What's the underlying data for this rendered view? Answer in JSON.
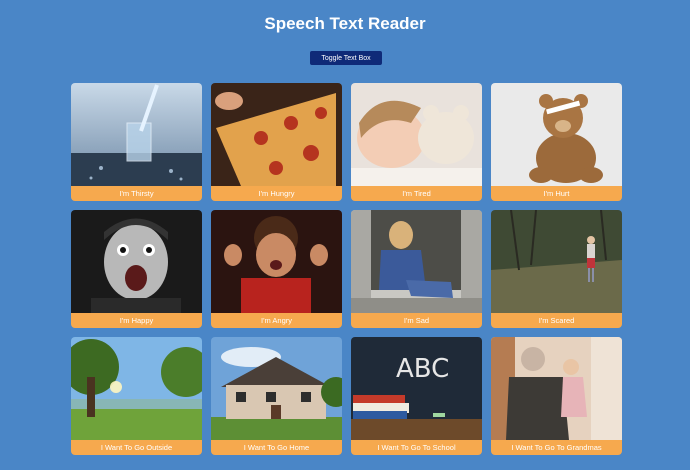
{
  "header": {
    "title": "Speech Text Reader"
  },
  "toolbar": {
    "toggle_label": "Toggle Text Box"
  },
  "cards": [
    {
      "label": "I'm Thirsty"
    },
    {
      "label": "I'm Hungry"
    },
    {
      "label": "I'm Tired"
    },
    {
      "label": "I'm Hurt"
    },
    {
      "label": "I'm Happy"
    },
    {
      "label": "I'm Angry"
    },
    {
      "label": "I'm Sad"
    },
    {
      "label": "I'm Scared"
    },
    {
      "label": "I Want To Go Outside"
    },
    {
      "label": "I Want To Go Home"
    },
    {
      "label": "I Want To Go To School"
    },
    {
      "label": "I Want To Go To Grandmas"
    }
  ],
  "colors": {
    "background": "#4a86c7",
    "button": "#0f2a78",
    "label_bar": "#f6a94e"
  }
}
